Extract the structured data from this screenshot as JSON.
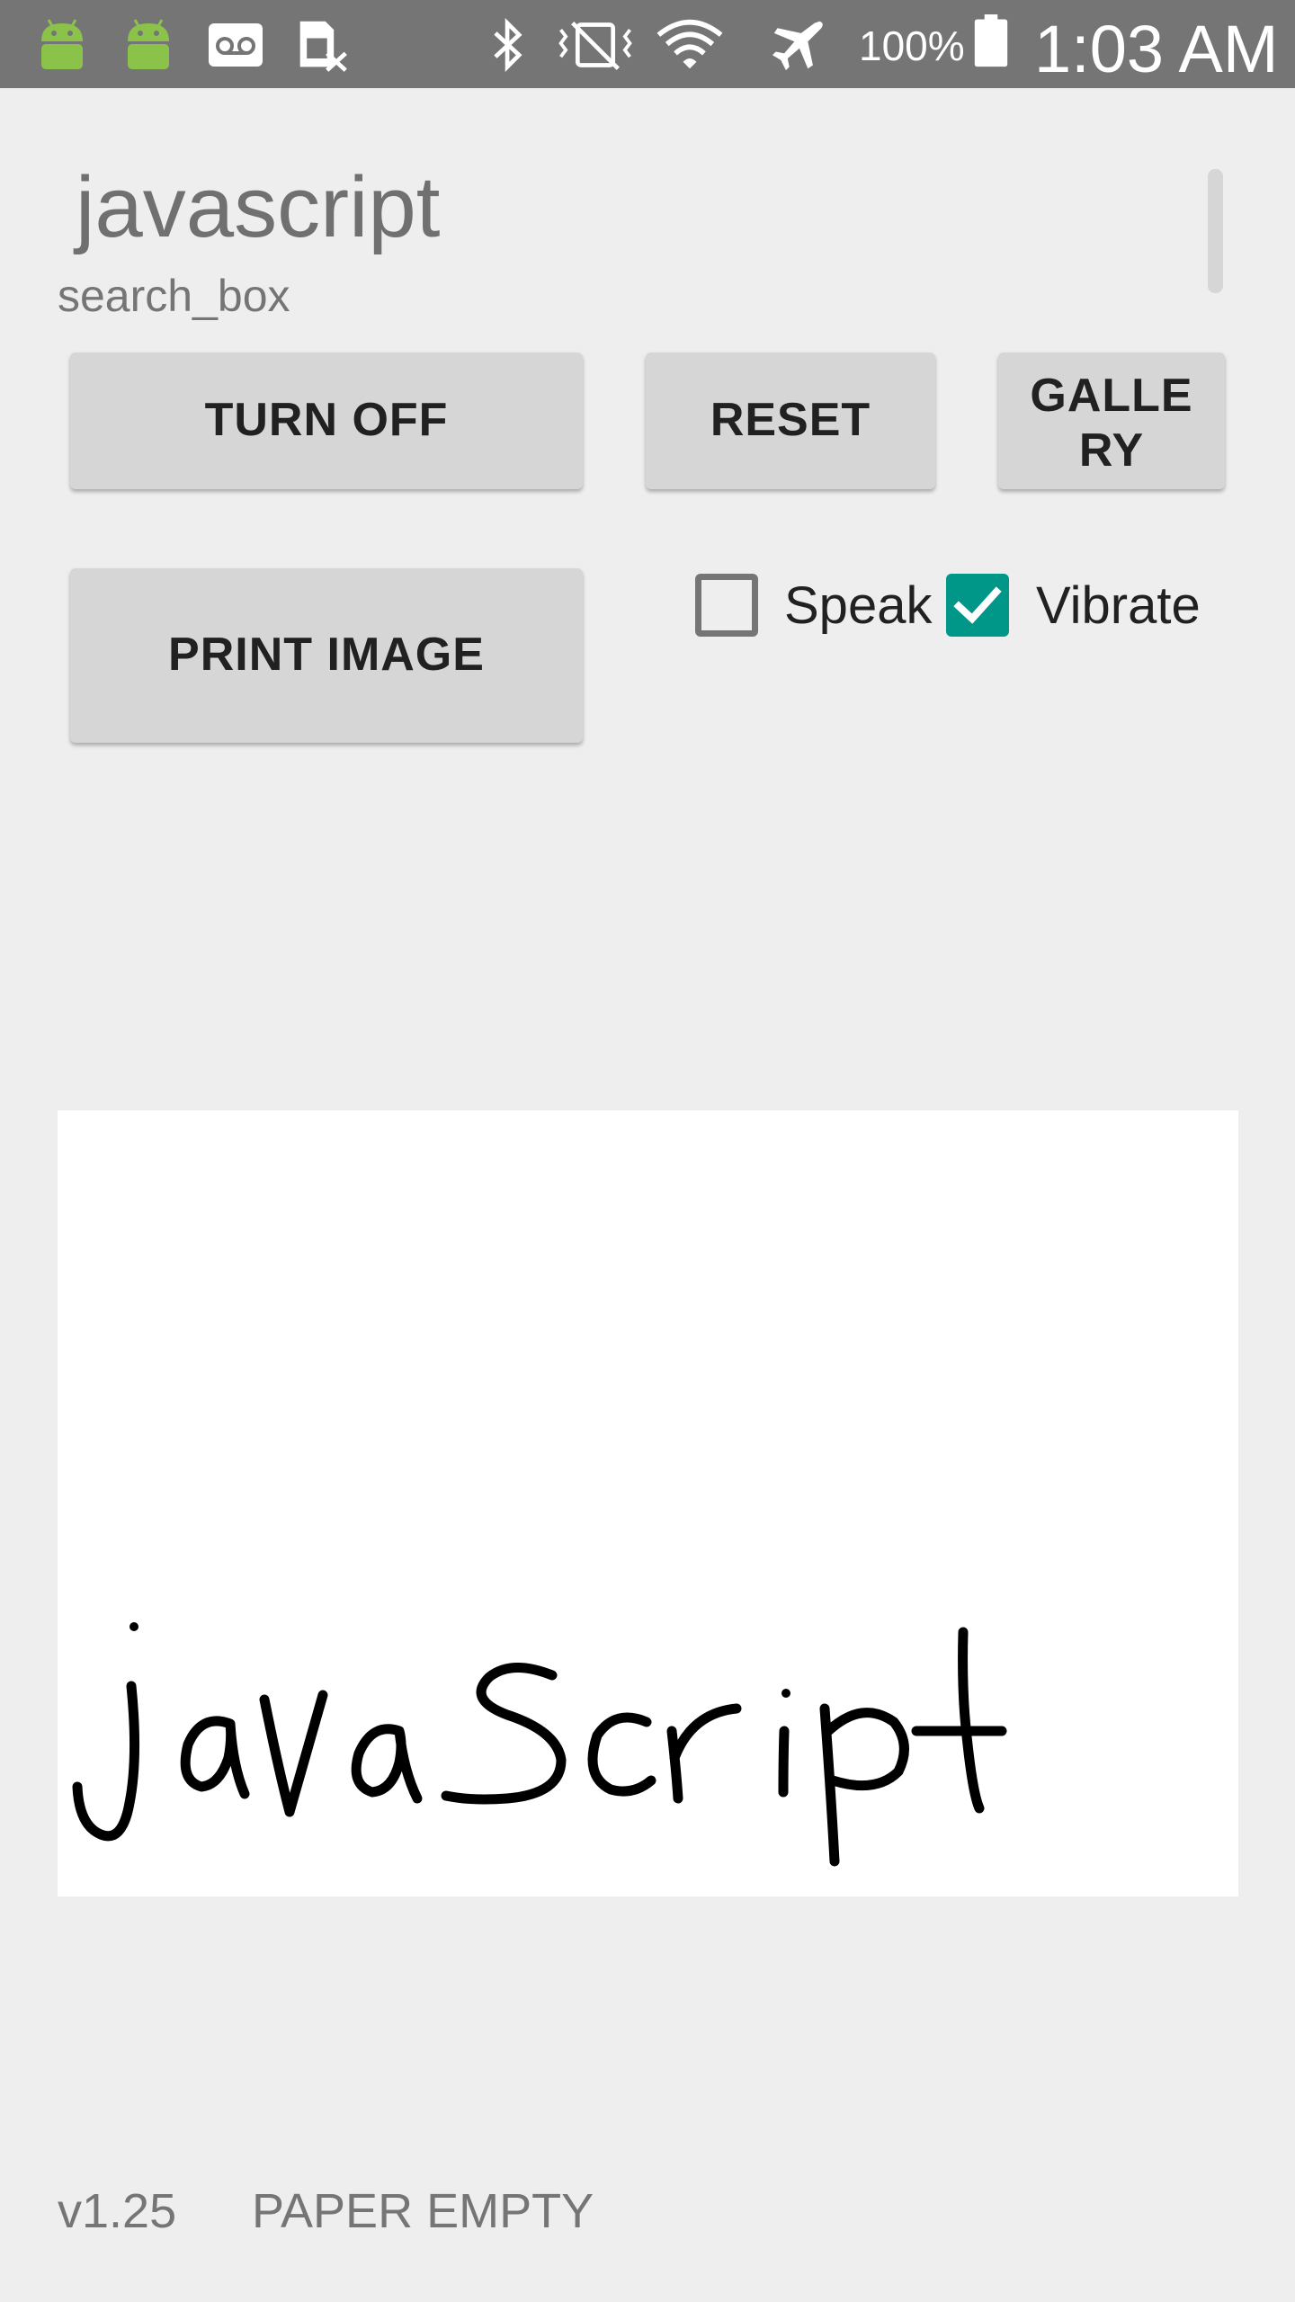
{
  "status_bar": {
    "icons": [
      "android-icon",
      "android-icon",
      "voicemail-icon",
      "sim-disabled-icon",
      "bluetooth-icon",
      "vibrate-muted-icon",
      "wifi-icon",
      "airplane-mode-icon",
      "battery-icon"
    ],
    "battery_percent": "100%",
    "time": "1:03 AM",
    "background_color": "#757575"
  },
  "search": {
    "value": "javascript",
    "hint": "search_box"
  },
  "buttons": {
    "turn_off": "TURN OFF",
    "reset": "RESET",
    "gallery": "GALLE\nRY",
    "print_image": "PRINT IMAGE"
  },
  "options": {
    "speak": {
      "label": "Speak",
      "checked": false
    },
    "vibrate": {
      "label": "Vibrate",
      "checked": true
    },
    "accent_color": "#009688"
  },
  "canvas": {
    "handwritten_text": "javascript"
  },
  "footer": {
    "version": "v1.25",
    "paper_status": "PAPER EMPTY"
  }
}
